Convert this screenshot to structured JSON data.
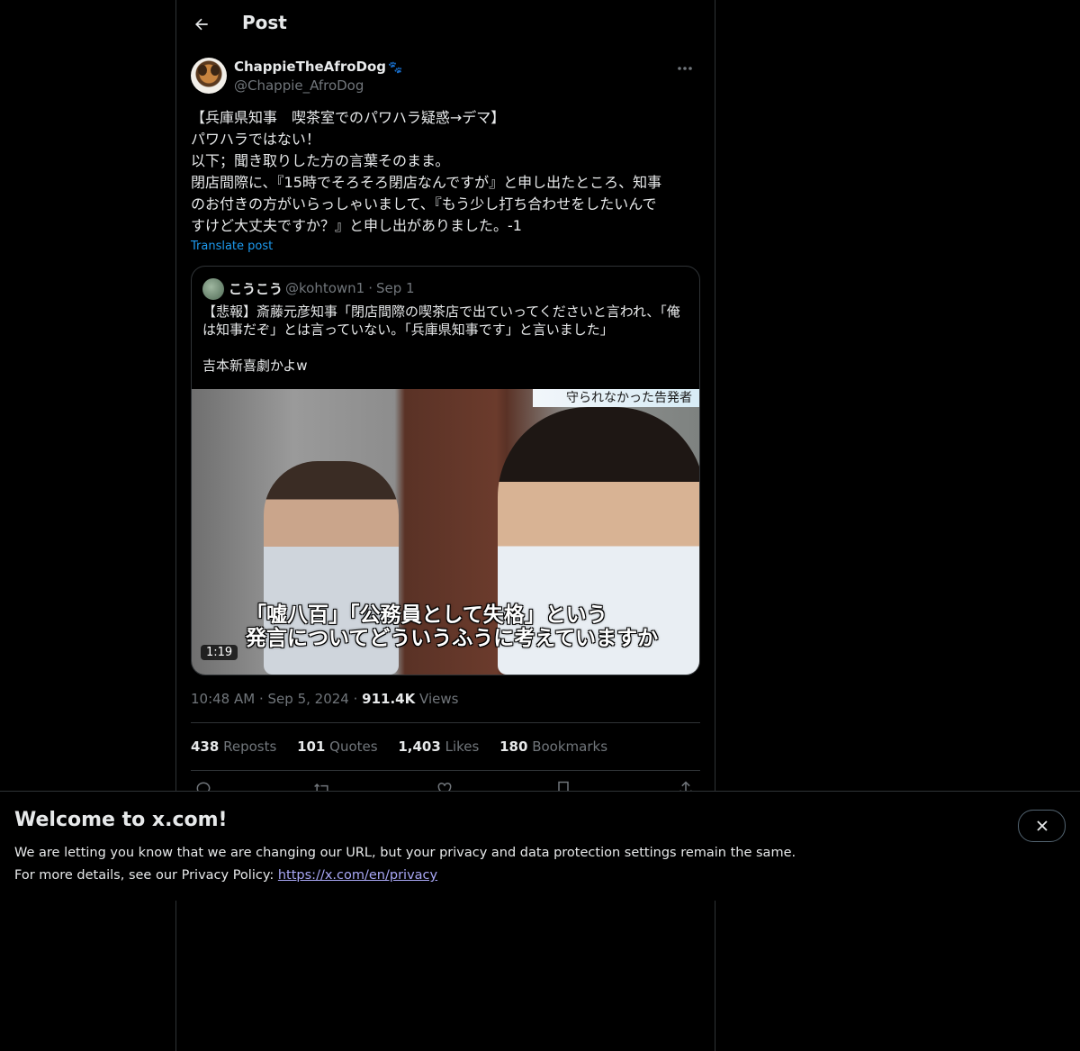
{
  "header": {
    "title": "Post"
  },
  "author": {
    "display_name": "ChappieTheAfroDog",
    "handle": "@Chappie_AfroDog"
  },
  "post": {
    "text": "【兵庫県知事　喫茶室でのパワハラ疑惑→デマ】\nパワハラではない！\n以下；聞き取りした方の言葉そのまま。\n閉店間際に、『15時でそろそろ閉店なんですが』と申し出たところ、知事\nのお付きの方がいらっしゃいまして、『もう少し打ち合わせをしたいんで\nすけど大丈夫ですか？』と申し出がありました。-1",
    "translate_label": "Translate post",
    "time": "10:48 AM",
    "date": "Sep 5, 2024",
    "views_count": "911.4K",
    "views_label": "Views"
  },
  "quote": {
    "display_name": "こうこう",
    "handle": "@kohtown1",
    "date": "Sep 1",
    "text": "【悲報】斎藤元彦知事「閉店間際の喫茶店で出ていってくださいと言われ、「俺\nは知事だぞ」とは言っていない。「兵庫県知事です」と言いました」\n\n吉本新喜劇かよw",
    "video": {
      "duration": "1:19",
      "banner_text": "守られなかった告発者",
      "caption": "「嘘八百」「公務員として失格」という\n発言についてどういうふうに考えていますか"
    }
  },
  "stats": {
    "reposts": {
      "count": "438",
      "label": "Reposts"
    },
    "quotes": {
      "count": "101",
      "label": "Quotes"
    },
    "likes": {
      "count": "1,403",
      "label": "Likes"
    },
    "bookmarks": {
      "count": "180",
      "label": "Bookmarks"
    }
  },
  "banner": {
    "title": "Welcome to x.com!",
    "line1": "We are letting you know that we are changing our URL, but your privacy and data protection settings remain the same.",
    "line2_prefix": "For more details, see our Privacy Policy: ",
    "link_text": "https://x.com/en/privacy"
  },
  "icons": {
    "back": "arrow-left-icon",
    "more": "more-horizontal-icon",
    "reply": "reply-icon",
    "repost": "repost-icon",
    "like": "heart-icon",
    "bookmark": "bookmark-icon",
    "share": "share-icon",
    "close": "close-icon"
  },
  "colors": {
    "background": "#000000",
    "text": "#e7e9ea",
    "secondary_text": "#71767b",
    "link": "#1d9bf0",
    "border": "#2f3336"
  }
}
